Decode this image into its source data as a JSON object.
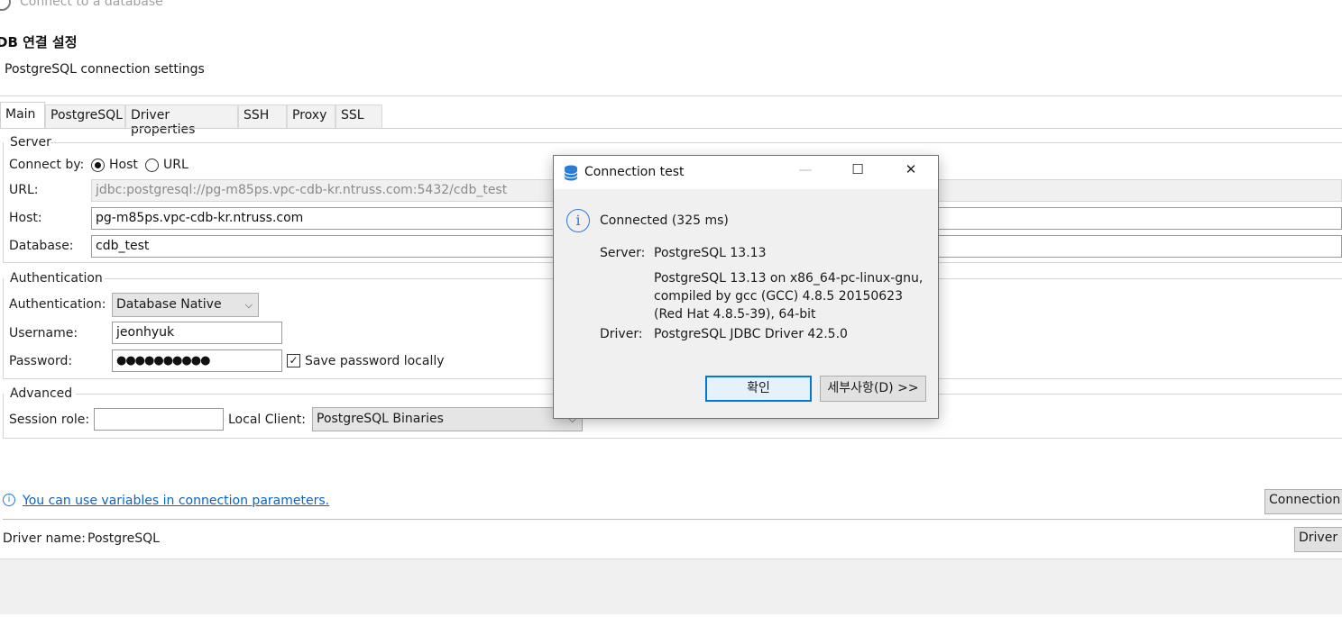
{
  "window": {
    "title": "Connect to a database"
  },
  "page": {
    "title": "DB 연결 설정",
    "subtitle": "PostgreSQL connection settings"
  },
  "tabs": [
    {
      "label": "Main",
      "active": true
    },
    {
      "label": "PostgreSQL"
    },
    {
      "label": "Driver properties"
    },
    {
      "label": "SSH"
    },
    {
      "label": "Proxy"
    },
    {
      "label": "SSL"
    }
  ],
  "server": {
    "group_label": "Server",
    "connect_by_label": "Connect by:",
    "host_option": "Host",
    "url_option": "URL",
    "selected": "Host",
    "url_label": "URL:",
    "url_value": "jdbc:postgresql://pg-m85ps.vpc-cdb-kr.ntruss.com:5432/cdb_test",
    "host_label": "Host:",
    "host_value": "pg-m85ps.vpc-cdb-kr.ntruss.com",
    "database_label": "Database:",
    "database_value": "cdb_test"
  },
  "auth": {
    "group_label": "Authentication",
    "auth_label": "Authentication:",
    "auth_value": "Database Native",
    "username_label": "Username:",
    "username_value": "jeonhyuk",
    "password_label": "Password:",
    "password_value": "●●●●●●●●●●",
    "save_password_label": "Save password locally",
    "save_password_checked": true
  },
  "advanced": {
    "group_label": "Advanced",
    "session_role_label": "Session role:",
    "session_role_value": "",
    "local_client_label": "Local Client:",
    "local_client_value": "PostgreSQL Binaries"
  },
  "footer": {
    "variables_link": "You can use variables in connection parameters.",
    "connection_button": "Connection",
    "driver_name_label": "Driver name:",
    "driver_name_value": "PostgreSQL",
    "driver_button": "Driver S"
  },
  "dialog": {
    "title": "Connection test",
    "status": "Connected (325 ms)",
    "server_label": "Server:",
    "server_lines": [
      "PostgreSQL 13.13",
      "PostgreSQL 13.13 on x86_64-pc-linux-gnu, compiled by gcc (GCC) 4.8.5 20150623 (Red Hat 4.8.5-39), 64-bit"
    ],
    "driver_label": "Driver:",
    "driver_value": "PostgreSQL JDBC Driver 42.5.0",
    "ok_button": "확인",
    "details_button": "세부사항(D) >>",
    "minimize_glyph": "—",
    "maximize_glyph": "☐",
    "close_glyph": "✕"
  }
}
